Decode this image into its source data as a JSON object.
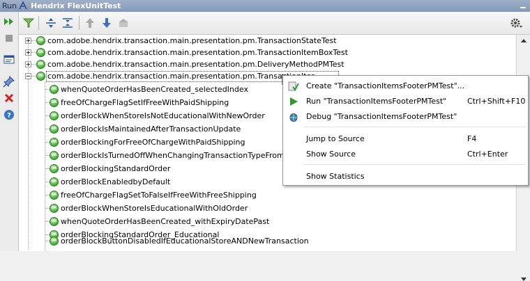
{
  "window": {
    "run_label": "Run",
    "title": "Hendrix FlexUnitTest"
  },
  "icons": {
    "title": "flexunit-run-config-icon",
    "rerun": "rerun-icon",
    "stop": "stop-icon",
    "layout": "layout-icon",
    "pin": "pin-icon",
    "close": "close-icon",
    "help": "help-icon",
    "filter": "filter-icon",
    "expand_all": "expand-all-icon",
    "collapse_all": "collapse-all-icon",
    "prev": "up-arrow-icon",
    "next": "down-arrow-icon",
    "import": "import-icon",
    "settings": "settings-gear-icon"
  },
  "tree": {
    "roots": [
      {
        "label": "com.adobe.hendrix.transaction.main.presentation.pm.TransactionStateTest",
        "expanded": false,
        "status": "ok"
      },
      {
        "label": "com.adobe.hendrix.transaction.main.presentation.pm.TransactionItemBoxTest",
        "expanded": false,
        "status": "ok"
      },
      {
        "label": "com.adobe.hendrix.transaction.main.presentation.pm.DeliveryMethodPMTest",
        "expanded": false,
        "status": "ok"
      },
      {
        "label": "com.adobe.hendrix.transaction.main.presentation.pm.TransactionIter",
        "expanded": true,
        "status": "ok",
        "selected": true
      }
    ],
    "children": [
      "whenQuoteOrderHasBeenCreated_selectedIndex",
      "freeOfChargeFlagSetIfFreeWithPaidShipping",
      "orderBlockWhenStoreIsNotEducationalWithNewOrder",
      "orderBlockIsMaintainedAfterTransactionUpdate",
      "orderBlockingForFreeOfChargeWithPaidShipping",
      "orderBlockIsTurnedOffWhenChangingTransactionTypeFromCrossP",
      "orderBlockingStandardOrder",
      "orderBlockEnabledbyDefault",
      "freeOfChargeFlagSetToFalseIfFreeWithFreeShipping",
      "orderBlockWhenStoreIsEducationalWithOldOrder",
      "whenQuoteOrderHasBeenCreated_withExpiryDatePast",
      "orderBlockingStandardOrder_Educational",
      "orderBlockButtonDisabledIfEducationalStoreANDNewTransaction"
    ],
    "ok_badge": "OK"
  },
  "context_menu": {
    "create": {
      "label": "Create  \"TransactionItemsFooterPMTest\"...",
      "shortcut": ""
    },
    "run": {
      "label": "Run \"TransactionItemsFooterPMTest\"",
      "shortcut": "Ctrl+Shift+F10"
    },
    "debug": {
      "label": "Debug \"TransactionItemsFooterPMTest\"",
      "shortcut": ""
    },
    "jump": {
      "label": "Jump to Source",
      "shortcut": "F4"
    },
    "show_source": {
      "label": "Show Source",
      "shortcut": "Ctrl+Enter"
    },
    "stats": {
      "label": "Show Statistics",
      "shortcut": ""
    }
  }
}
